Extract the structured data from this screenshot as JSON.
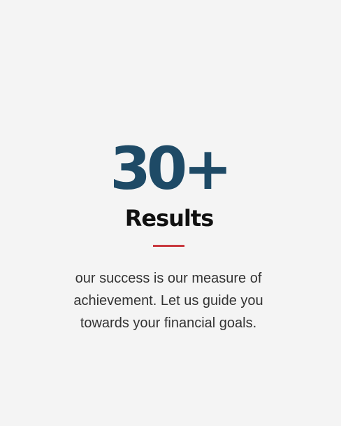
{
  "stat": {
    "value": "30+",
    "label": "Results"
  },
  "description": "our success is our measure of achievement. Let us guide you towards your financial goals.",
  "colors": {
    "background": "#f4f4f4",
    "stat_value": "#1e4a66",
    "stat_label": "#111111",
    "accent": "#c9393f",
    "body_text": "#333333"
  }
}
